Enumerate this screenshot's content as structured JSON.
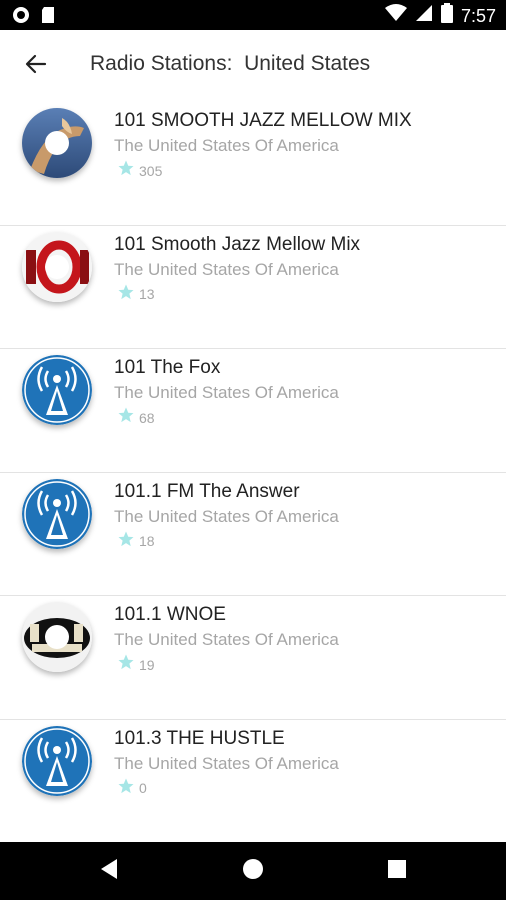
{
  "status_bar": {
    "time": "7:57",
    "icons": [
      "record-icon",
      "sd-card-icon",
      "wifi-icon",
      "cellular-icon",
      "battery-icon"
    ]
  },
  "app_bar": {
    "back_icon": "back-arrow-icon",
    "title": "Radio Stations:  United States"
  },
  "colors": {
    "star": "#a6e6e6",
    "badge_blue": "#1f73b8",
    "divider": "#e3e3e3"
  },
  "stations": [
    {
      "name": "101 SMOOTH JAZZ MELLOW MIX",
      "country": "The United States Of America",
      "rating": "305",
      "logo": "saxophone-photo-logo"
    },
    {
      "name": "101 Smooth Jazz Mellow Mix",
      "country": "The United States Of America",
      "rating": "13",
      "logo": "red-101-logo"
    },
    {
      "name": "101 The Fox",
      "country": "The United States Of America",
      "rating": "68",
      "logo": "radio-tower-icon"
    },
    {
      "name": "101.1 FM The Answer",
      "country": "The United States Of America",
      "rating": "18",
      "logo": "radio-tower-icon"
    },
    {
      "name": "101.1 WNOE",
      "country": "The United States Of America",
      "rating": "19",
      "logo": "wnoe-logo"
    },
    {
      "name": "101.3 THE HUSTLE",
      "country": "The United States Of America",
      "rating": "0",
      "logo": "radio-tower-icon"
    }
  ],
  "nav_bar": {
    "items": [
      "back-triangle-icon",
      "home-circle-icon",
      "recents-square-icon"
    ]
  }
}
